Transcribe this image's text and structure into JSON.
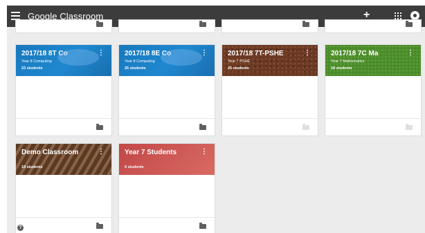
{
  "app": {
    "title": "Google Classroom"
  },
  "toolbar": {
    "plus_symbol": "+"
  },
  "icons": {
    "menu": "menu-icon",
    "add": "plus-icon",
    "apps": "apps-grid-icon",
    "account": "account-circle-icon",
    "more": "more-vert-icon",
    "folder": "folder-icon",
    "help": "help-icon"
  },
  "more_symbol": "⋮",
  "help_symbol": "?",
  "colors": {
    "topbar": "#3c3c3c",
    "computing": "#1e88cf",
    "pshe": "#6b3a25",
    "maths": "#4c8b2b",
    "demo": "#6e4a30",
    "year7": "#c9514e",
    "background": "#ececec"
  },
  "classes": [
    {
      "title": "2017/18 8T Co",
      "subtitle": "Year 8 Computing",
      "students": "23 students"
    },
    {
      "title": "2017/18 8E Co",
      "subtitle": "Year 8 Computing",
      "students": "25 students"
    },
    {
      "title": "2017/18 7T-PSHE",
      "subtitle": "Year 7 PSHE",
      "students": "25 students"
    },
    {
      "title": "2017/18 7C Ma",
      "subtitle": "Year 7 Mathematics",
      "students": "18 students"
    },
    {
      "title": "Demo Classroom",
      "subtitle": "",
      "students": "19 students"
    },
    {
      "title": "Year 7 Students",
      "subtitle": "",
      "students": "0 students"
    }
  ]
}
